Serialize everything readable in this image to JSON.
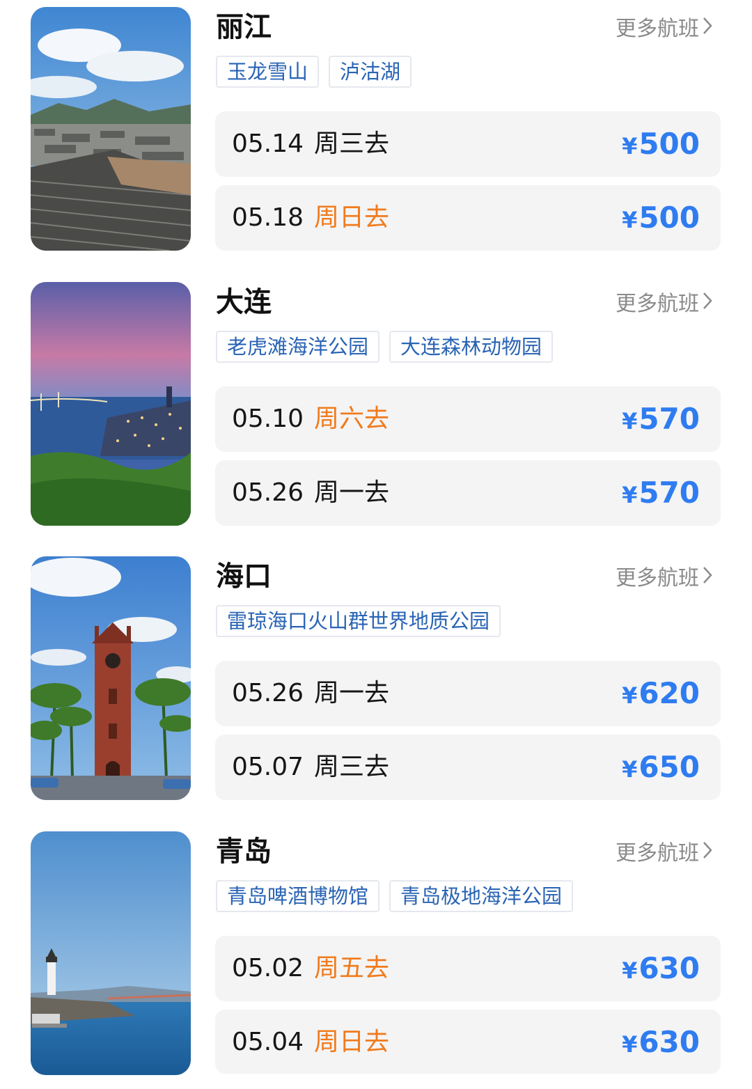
{
  "more_label": "更多航班",
  "colors": {
    "price": "#2f7cf0",
    "weekend_day": "#f07b1d",
    "tag_text": "#2a64b4",
    "row_bg": "#f4f4f5"
  },
  "destinations": [
    {
      "city": "丽江",
      "image": "lijiang-old-town-rooftops",
      "tags": [
        "玉龙雪山",
        "泸沽湖"
      ],
      "flights": [
        {
          "date": "05.14",
          "day": "周三去",
          "weekend": false,
          "currency": "¥",
          "price": "500"
        },
        {
          "date": "05.18",
          "day": "周日去",
          "weekend": true,
          "currency": "¥",
          "price": "500"
        }
      ]
    },
    {
      "city": "大连",
      "image": "dalian-bay-at-dusk",
      "tags": [
        "老虎滩海洋公园",
        "大连森林动物园"
      ],
      "flights": [
        {
          "date": "05.10",
          "day": "周六去",
          "weekend": true,
          "currency": "¥",
          "price": "570"
        },
        {
          "date": "05.26",
          "day": "周一去",
          "weekend": false,
          "currency": "¥",
          "price": "570"
        }
      ]
    },
    {
      "city": "海口",
      "image": "haikou-clock-tower-palms",
      "tags": [
        "雷琼海口火山群世界地质公园"
      ],
      "flights": [
        {
          "date": "05.26",
          "day": "周一去",
          "weekend": false,
          "currency": "¥",
          "price": "620"
        },
        {
          "date": "05.07",
          "day": "周三去",
          "weekend": false,
          "currency": "¥",
          "price": "650"
        }
      ]
    },
    {
      "city": "青岛",
      "image": "qingdao-lighthouse-sea",
      "tags": [
        "青岛啤酒博物馆",
        "青岛极地海洋公园"
      ],
      "flights": [
        {
          "date": "05.02",
          "day": "周五去",
          "weekend": true,
          "currency": "¥",
          "price": "630"
        },
        {
          "date": "05.04",
          "day": "周日去",
          "weekend": true,
          "currency": "¥",
          "price": "630"
        }
      ]
    }
  ]
}
